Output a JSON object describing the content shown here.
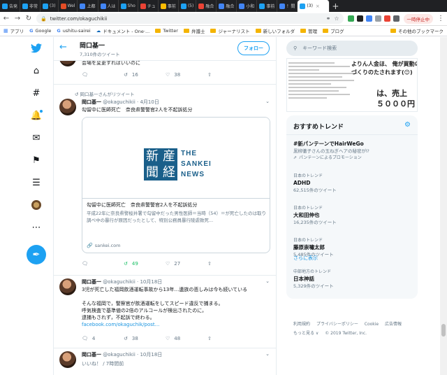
{
  "browser": {
    "tabs": [
      {
        "label": "告発",
        "color": "#1da1f2"
      },
      {
        "label": "非常",
        "color": "#1da1f2"
      },
      {
        "label": "(3)",
        "color": "#1da1f2"
      },
      {
        "label": "Wel",
        "color": "#e44d26"
      },
      {
        "label": "上都",
        "color": "#4285f4"
      },
      {
        "label": "人は",
        "color": "#4285f4"
      },
      {
        "label": "Sho",
        "color": "#1da1f2"
      },
      {
        "label": "チュ",
        "color": "#ea4335"
      },
      {
        "label": "事前",
        "color": "#fbbc04"
      },
      {
        "label": "(5)",
        "color": "#1da1f2"
      },
      {
        "label": "融合",
        "color": "#ea4335"
      },
      {
        "label": "融合",
        "color": "#4285f4"
      },
      {
        "label": "小和",
        "color": "#4285f4"
      },
      {
        "label": "事前",
        "color": "#1da1f2"
      },
      {
        "label": "！間",
        "color": "#4285f4"
      }
    ],
    "active_tab": {
      "label": "(3)",
      "close": "×"
    },
    "new_tab": "+",
    "url": "twitter.com/okaguchikii",
    "paused_label": "一時停止中",
    "bookmarks": [
      {
        "label": "アプリ",
        "type": "apps"
      },
      {
        "label": "Google",
        "type": "g"
      },
      {
        "label": "ushitu-sairei",
        "type": "g"
      },
      {
        "label": "ドキュメント - One·...",
        "type": "cloud"
      },
      {
        "label": "Twitter",
        "type": "folder"
      },
      {
        "label": "弁護士",
        "type": "folder"
      },
      {
        "label": "ジャーナリスト",
        "type": "folder"
      },
      {
        "label": "新しいフォルダ",
        "type": "folder"
      },
      {
        "label": "管理",
        "type": "folder"
      },
      {
        "label": "ブログ",
        "type": "folder"
      }
    ],
    "other_bookmarks": "その他のブックマーク"
  },
  "header": {
    "name": "岡口基一",
    "tweet_count": "7,310件のツイート",
    "follow_label": "フォロー"
  },
  "tweets": {
    "t0": {
      "text": "会場を変更すればいいのに",
      "reply": "",
      "retweet": "16",
      "like": "38"
    },
    "t1": {
      "rt_label": "岡口基一さんがリツイート",
      "name": "岡口基一",
      "handle": "@okaguchikii · 4月10日",
      "text": "勾留中に医師死亡　奈良県警警官2人を不起訴処分",
      "card": {
        "logo_chars": [
          "産",
          "経",
          "新",
          "聞"
        ],
        "logo_text": [
          "THE",
          "SANKEI",
          "NEWS"
        ],
        "title": "勾留中に医師死亡　奈良県警警官2人を不起訴処分",
        "desc": "平成22年に奈良県警桜井署で勾留中だった男性医師＝当時（54）＝が死亡したのは取り調べ中の暴行が原因だったとして、特別公務員暴行陵虐致死...",
        "domain": "sankei.com"
      },
      "reply": "",
      "retweet": "49",
      "like": "27"
    },
    "t2": {
      "name": "岡口基一",
      "handle": "@okaguchikii · 10月18日",
      "text": "3児が死亡した福岡飲酒運転事故から13年…遺族の悲しみは今も続いている\n\nそんな福岡で，警察官が飲酒運転をしてスピード違反で捕まる。\n呼気検査で基準値の2倍のアルコールが検出されたのに，\n逮捕もされず，不起訴で終わる。",
      "link": "facebook.com/okaguchik/post...",
      "reply": "4",
      "retweet": "38",
      "like": "48"
    },
    "t3": {
      "name": "岡口基一",
      "handle": "@okaguchikii · 10月18日",
      "text": "いいね！ / 7時間前"
    }
  },
  "search": {
    "placeholder": "キーワード検索"
  },
  "ad": {
    "line1": "よりん人金ほ、 俺が買動の",
    "line2": "づくりのたされます(😊)",
    "line3": "は、売上",
    "line4": "５０００円"
  },
  "trends": {
    "title": "おすすめトレンド",
    "items": [
      {
        "ctx": "",
        "name": "#新パンテーンでHairWeGo",
        "desc": "黒柳徹子さんの玉ねぎヘアの秘密が⁉",
        "promo": "パンテーンによるプロモーション"
      },
      {
        "ctx": "日本のトレンド",
        "name": "ADHD",
        "count": "62,515件のツイート"
      },
      {
        "ctx": "日本のトレンド",
        "name": "大和田伸也",
        "count": "16,235件のツイート"
      },
      {
        "ctx": "日本のトレンド",
        "name": "藤原崇嘯太郎",
        "count": "5,485件のツイート"
      },
      {
        "ctx": "中部地方のトレンド",
        "name": "日本神話",
        "count": "5,329件のツイート"
      }
    ],
    "show_more": "さらに表示"
  },
  "footer": {
    "links": [
      "利用規約",
      "プライバシーポリシー",
      "Cookie",
      "広告情報",
      "もっと見る ∨",
      "© 2019 Twitter, Inc."
    ]
  },
  "colors": {
    "twitter_blue": "#1da1f2",
    "retweet_green": "#17bf63",
    "sankei_blue": "#1a5f8a"
  }
}
